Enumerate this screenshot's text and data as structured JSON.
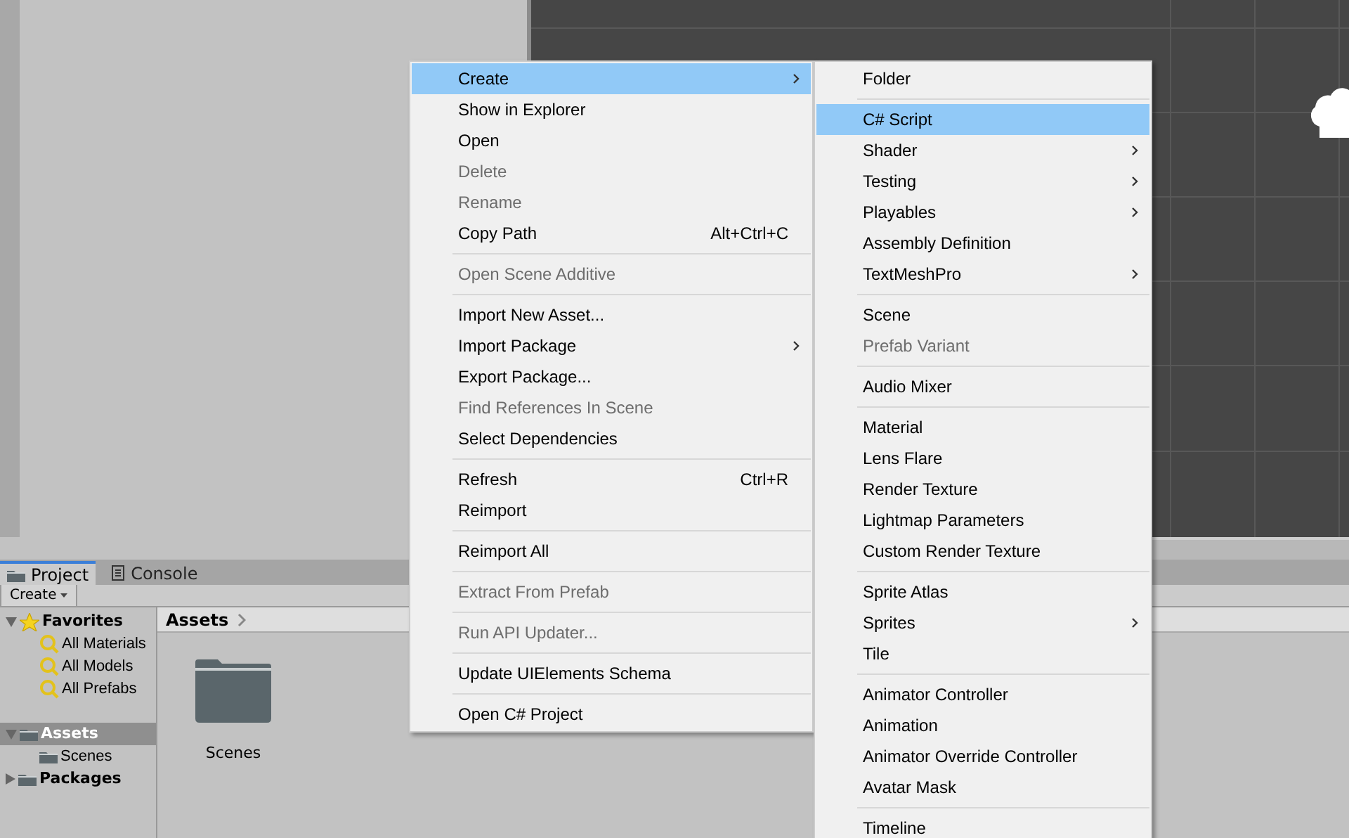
{
  "project_panel": {
    "tabs": [
      {
        "label": "Project",
        "kind": "folder",
        "selected": true
      },
      {
        "label": "Console",
        "kind": "console",
        "selected": false
      }
    ],
    "toolbar": {
      "create_button": "Create"
    },
    "tree": [
      {
        "label": "Favorites",
        "kind": "favorites",
        "expanded": true,
        "selected": false,
        "children": [
          {
            "label": "All Materials",
            "kind": "search",
            "selected": false
          },
          {
            "label": "All Models",
            "kind": "search",
            "selected": false
          },
          {
            "label": "All Prefabs",
            "kind": "search",
            "selected": false
          }
        ]
      },
      {
        "label": "Assets",
        "kind": "folder",
        "expanded": true,
        "selected": true,
        "children": [
          {
            "label": "Scenes",
            "kind": "folder",
            "selected": false
          }
        ]
      },
      {
        "label": "Packages",
        "kind": "folder",
        "expanded": false,
        "selected": false
      }
    ],
    "breadcrumb": [
      "Assets"
    ],
    "files": [
      {
        "label": "Scenes",
        "kind": "folder"
      }
    ]
  },
  "context_menu": {
    "items": [
      {
        "kind": "item",
        "label": "Create",
        "submenu": true,
        "selected": true,
        "disabled": false
      },
      {
        "kind": "item",
        "label": "Show in Explorer",
        "submenu": false,
        "selected": false,
        "disabled": false
      },
      {
        "kind": "item",
        "label": "Open",
        "submenu": false,
        "selected": false,
        "disabled": false
      },
      {
        "kind": "item",
        "label": "Delete",
        "submenu": false,
        "selected": false,
        "disabled": true
      },
      {
        "kind": "item",
        "label": "Rename",
        "submenu": false,
        "selected": false,
        "disabled": true
      },
      {
        "kind": "item",
        "label": "Copy Path",
        "shortcut": "Alt+Ctrl+C",
        "submenu": false,
        "selected": false,
        "disabled": false
      },
      {
        "kind": "separator"
      },
      {
        "kind": "item",
        "label": "Open Scene Additive",
        "submenu": false,
        "selected": false,
        "disabled": true
      },
      {
        "kind": "separator"
      },
      {
        "kind": "item",
        "label": "Import New Asset...",
        "submenu": false,
        "selected": false,
        "disabled": false
      },
      {
        "kind": "item",
        "label": "Import Package",
        "submenu": true,
        "selected": false,
        "disabled": false
      },
      {
        "kind": "item",
        "label": "Export Package...",
        "submenu": false,
        "selected": false,
        "disabled": false
      },
      {
        "kind": "item",
        "label": "Find References In Scene",
        "submenu": false,
        "selected": false,
        "disabled": true
      },
      {
        "kind": "item",
        "label": "Select Dependencies",
        "submenu": false,
        "selected": false,
        "disabled": false
      },
      {
        "kind": "separator"
      },
      {
        "kind": "item",
        "label": "Refresh",
        "shortcut": "Ctrl+R",
        "submenu": false,
        "selected": false,
        "disabled": false
      },
      {
        "kind": "item",
        "label": "Reimport",
        "submenu": false,
        "selected": false,
        "disabled": false
      },
      {
        "kind": "separator"
      },
      {
        "kind": "item",
        "label": "Reimport All",
        "submenu": false,
        "selected": false,
        "disabled": false
      },
      {
        "kind": "separator"
      },
      {
        "kind": "item",
        "label": "Extract From Prefab",
        "submenu": false,
        "selected": false,
        "disabled": true
      },
      {
        "kind": "separator"
      },
      {
        "kind": "item",
        "label": "Run API Updater...",
        "submenu": false,
        "selected": false,
        "disabled": true
      },
      {
        "kind": "separator"
      },
      {
        "kind": "item",
        "label": "Update UIElements Schema",
        "submenu": false,
        "selected": false,
        "disabled": false
      },
      {
        "kind": "separator"
      },
      {
        "kind": "item",
        "label": "Open C# Project",
        "submenu": false,
        "selected": false,
        "disabled": false
      }
    ]
  },
  "create_submenu": {
    "items": [
      {
        "kind": "item",
        "label": "Folder",
        "submenu": false,
        "selected": false,
        "disabled": false
      },
      {
        "kind": "separator"
      },
      {
        "kind": "item",
        "label": "C# Script",
        "submenu": false,
        "selected": true,
        "disabled": false
      },
      {
        "kind": "item",
        "label": "Shader",
        "submenu": true,
        "selected": false,
        "disabled": false
      },
      {
        "kind": "item",
        "label": "Testing",
        "submenu": true,
        "selected": false,
        "disabled": false
      },
      {
        "kind": "item",
        "label": "Playables",
        "submenu": true,
        "selected": false,
        "disabled": false
      },
      {
        "kind": "item",
        "label": "Assembly Definition",
        "submenu": false,
        "selected": false,
        "disabled": false
      },
      {
        "kind": "item",
        "label": "TextMeshPro",
        "submenu": true,
        "selected": false,
        "disabled": false
      },
      {
        "kind": "separator"
      },
      {
        "kind": "item",
        "label": "Scene",
        "submenu": false,
        "selected": false,
        "disabled": false
      },
      {
        "kind": "item",
        "label": "Prefab Variant",
        "submenu": false,
        "selected": false,
        "disabled": true
      },
      {
        "kind": "separator"
      },
      {
        "kind": "item",
        "label": "Audio Mixer",
        "submenu": false,
        "selected": false,
        "disabled": false
      },
      {
        "kind": "separator"
      },
      {
        "kind": "item",
        "label": "Material",
        "submenu": false,
        "selected": false,
        "disabled": false
      },
      {
        "kind": "item",
        "label": "Lens Flare",
        "submenu": false,
        "selected": false,
        "disabled": false
      },
      {
        "kind": "item",
        "label": "Render Texture",
        "submenu": false,
        "selected": false,
        "disabled": false
      },
      {
        "kind": "item",
        "label": "Lightmap Parameters",
        "submenu": false,
        "selected": false,
        "disabled": false
      },
      {
        "kind": "item",
        "label": "Custom Render Texture",
        "submenu": false,
        "selected": false,
        "disabled": false
      },
      {
        "kind": "separator"
      },
      {
        "kind": "item",
        "label": "Sprite Atlas",
        "submenu": false,
        "selected": false,
        "disabled": false
      },
      {
        "kind": "item",
        "label": "Sprites",
        "submenu": true,
        "selected": false,
        "disabled": false
      },
      {
        "kind": "item",
        "label": "Tile",
        "submenu": false,
        "selected": false,
        "disabled": false
      },
      {
        "kind": "separator"
      },
      {
        "kind": "item",
        "label": "Animator Controller",
        "submenu": false,
        "selected": false,
        "disabled": false
      },
      {
        "kind": "item",
        "label": "Animation",
        "submenu": false,
        "selected": false,
        "disabled": false
      },
      {
        "kind": "item",
        "label": "Animator Override Controller",
        "submenu": false,
        "selected": false,
        "disabled": false
      },
      {
        "kind": "item",
        "label": "Avatar Mask",
        "submenu": false,
        "selected": false,
        "disabled": false
      },
      {
        "kind": "separator"
      },
      {
        "kind": "item",
        "label": "Timeline",
        "submenu": false,
        "selected": false,
        "disabled": false
      }
    ]
  }
}
